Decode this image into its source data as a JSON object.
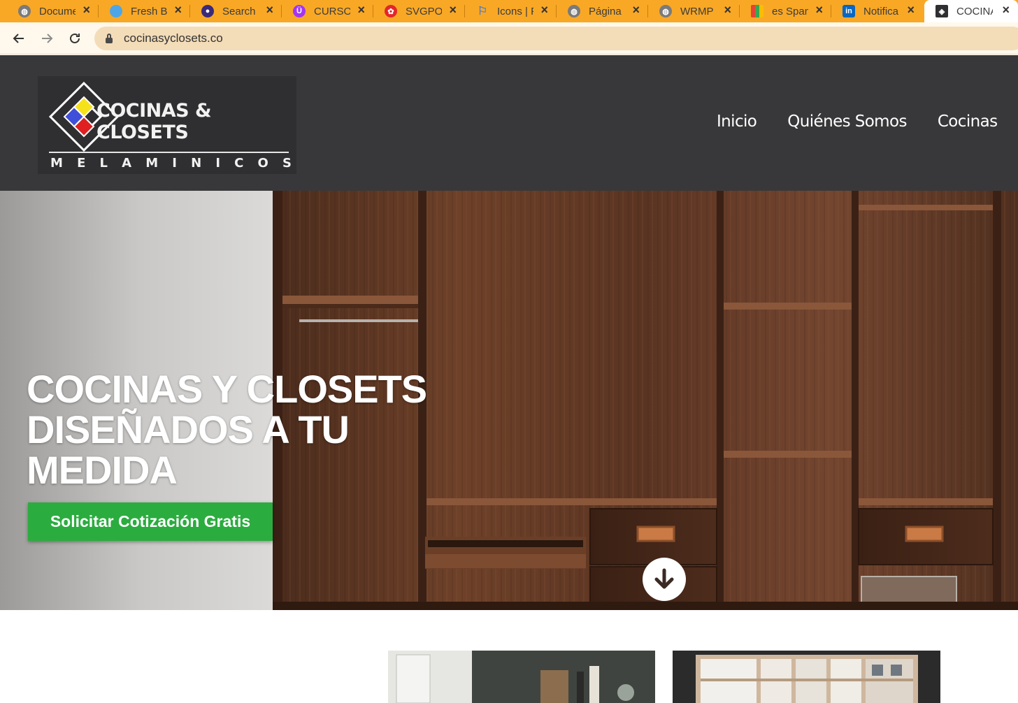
{
  "browser": {
    "tabs": [
      {
        "title": "Docume",
        "icon": "globe-icon",
        "color": "#7a7a7a"
      },
      {
        "title": "Fresh B",
        "icon": "freshworks-icon",
        "color": "#4ea6e8"
      },
      {
        "title": "Search",
        "icon": "search-app-icon",
        "color": "#3b2a7a"
      },
      {
        "title": "CURSO",
        "icon": "udemy-icon",
        "color": "#a435f0"
      },
      {
        "title": "SVGPO",
        "icon": "svgporn-icon",
        "color": "#e3262a"
      },
      {
        "title": "Icons | F",
        "icon": "flag-icon",
        "color": "#4a7fd4"
      },
      {
        "title": "Página",
        "icon": "globe-icon",
        "color": "#7a7a7a"
      },
      {
        "title": "WRMP",
        "icon": "globe-icon",
        "color": "#7a7a7a"
      },
      {
        "title": "es Span",
        "icon": "color-grid-icon",
        "color": "#e94235"
      },
      {
        "title": "Notifica",
        "icon": "linkedin-icon",
        "color": "#0a66c2"
      },
      {
        "title": "COCINA",
        "icon": "cocinas-logo-icon",
        "color": "#2f2f31",
        "active": true
      }
    ],
    "url": "cocinasyclosets.co"
  },
  "site": {
    "logo": {
      "title": "COCINAS & CLOSETS",
      "subtitle_letters": [
        "M",
        "E",
        "L",
        "A",
        "M",
        "I",
        "N",
        "I",
        "C",
        "O",
        "S"
      ],
      "colors": {
        "yellow": "#f5e21b",
        "blue": "#3f4fd9",
        "red": "#e02020"
      }
    },
    "nav": [
      "Inicio",
      "Quiénes Somos",
      "Cocinas"
    ],
    "hero": {
      "title_lines": [
        "COCINAS Y CLOSETS",
        "DISEÑADOS A TU",
        "MEDIDA"
      ],
      "cta_label": "Solicitar Cotización Gratis"
    }
  },
  "colors": {
    "tab_bar": "#f9a825",
    "header_bg": "#38383a",
    "cta_bg": "#2bac3f"
  }
}
